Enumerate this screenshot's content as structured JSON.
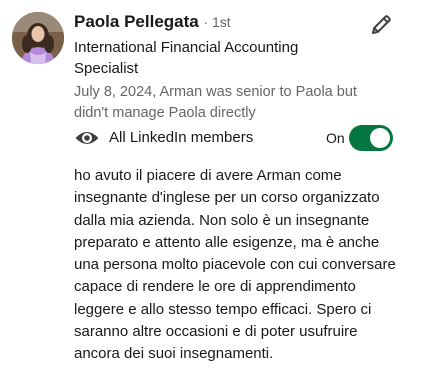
{
  "recommender": {
    "name": "Paola Pellegata",
    "degree": "· 1st",
    "headline": "International Financial Accounting Specialist",
    "meta": "July 8, 2024, Arman was senior to Paola but didn't manage Paola directly"
  },
  "visibility": {
    "label": "All LinkedIn members",
    "toggle_label": "On",
    "toggle_on": true,
    "icon": "eye-icon"
  },
  "actions": {
    "edit_icon": "pencil-icon"
  },
  "recommendation": {
    "text": "ho avuto il piacere di avere Arman come insegnante d'inglese per un corso organizzato dalla mia azienda. Non solo è un insegnante preparato e attento alle esigenze, ma è anche una persona molto piacevole con cui conversare capace di rendere le ore di apprendimento leggere e allo stesso tempo efficaci. Spero ci saranno altre occasioni e di poter usufruire ancora dei suoi insegnamenti."
  },
  "colors": {
    "toggle_on": "#057642",
    "text_primary": "#191919",
    "text_secondary": "#666666"
  }
}
